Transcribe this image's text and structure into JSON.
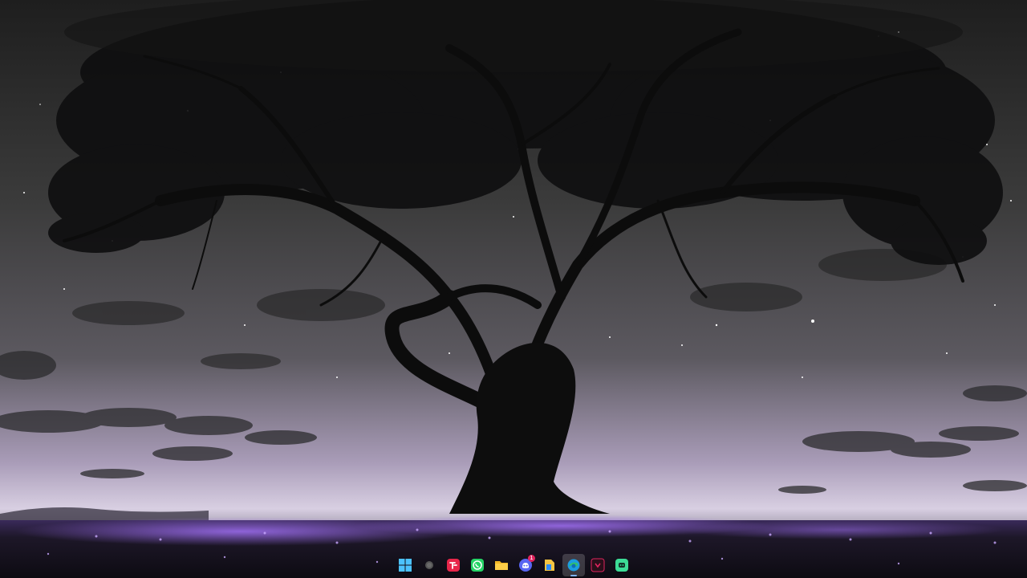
{
  "desktop": {
    "wallpaper": "night-tree-wallpaper",
    "colors": {
      "sky_top": "#262626",
      "sky_mid": "#4a4a4a",
      "horizon": "#b3a4c4",
      "ground": "#1a1626",
      "flowers": "#8a5ad8"
    }
  },
  "taskbar": {
    "items": [
      {
        "name": "start",
        "icon": "windows-logo-icon"
      },
      {
        "name": "search",
        "icon": "search-circle-icon"
      },
      {
        "name": "app-red",
        "icon": "red-app-icon"
      },
      {
        "name": "whatsapp",
        "icon": "whatsapp-icon"
      },
      {
        "name": "file-explorer",
        "icon": "folder-icon"
      },
      {
        "name": "discord",
        "icon": "discord-icon",
        "badge": "1"
      },
      {
        "name": "files",
        "icon": "file-manager-icon"
      },
      {
        "name": "edge",
        "icon": "edge-browser-icon",
        "active": true
      },
      {
        "name": "app-dark",
        "icon": "dark-app-icon"
      },
      {
        "name": "app-green",
        "icon": "green-app-icon"
      }
    ]
  }
}
